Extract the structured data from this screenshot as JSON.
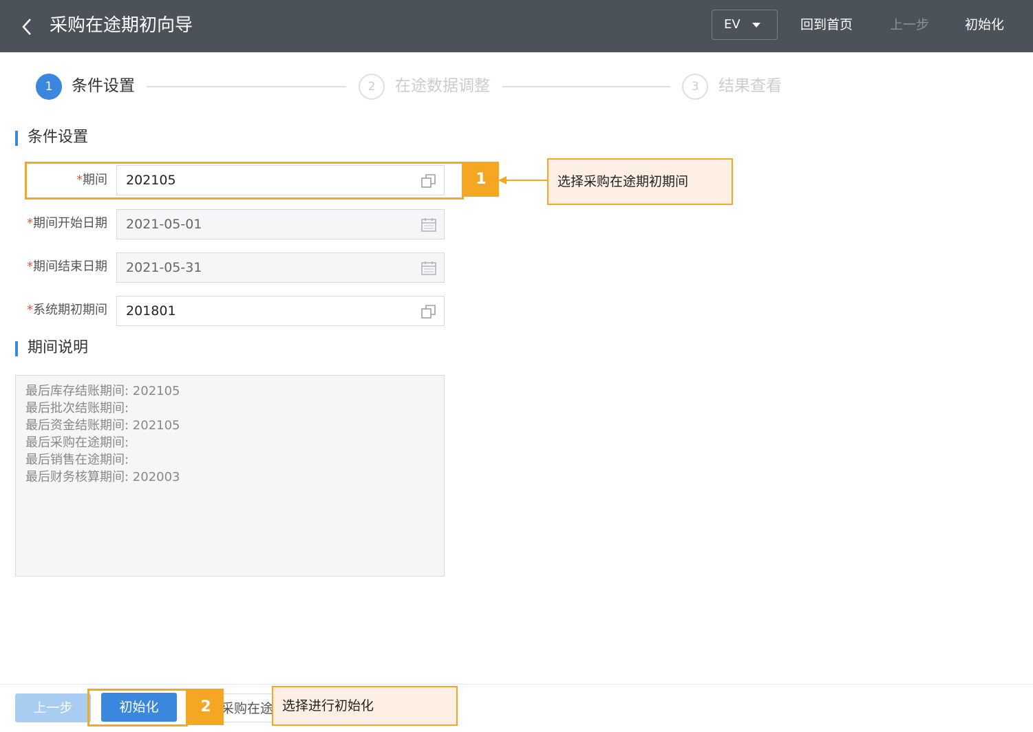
{
  "header": {
    "title": "采购在途期初向导",
    "org_select": "EV",
    "home_label": "回到首页",
    "prev_label": "上一步",
    "init_label": "初始化"
  },
  "steps": [
    {
      "num": "1",
      "label": "条件设置",
      "state": "active"
    },
    {
      "num": "2",
      "label": "在途数据调整",
      "state": "inactive"
    },
    {
      "num": "3",
      "label": "结果查看",
      "state": "inactive"
    }
  ],
  "sections": {
    "conditions": "条件设置",
    "period_note": "期间说明"
  },
  "form": {
    "required_mark": "*",
    "period": {
      "label": "期间",
      "value": "202105"
    },
    "start_date": {
      "label": "期间开始日期",
      "value": "2021-05-01"
    },
    "end_date": {
      "label": "期间结束日期",
      "value": "2021-05-31"
    },
    "system_period": {
      "label": "系统期初期间",
      "value": "201801"
    }
  },
  "period_note": {
    "lines": [
      "最后库存结账期间: 202105",
      "最后批次结账期间:",
      "最后资金结账期间: 202105",
      "最后采购在途期间:",
      "最后销售在途期间:",
      "最后财务核算期间: 202003"
    ]
  },
  "footer": {
    "prev_label": "上一步",
    "init_label": "初始化",
    "peek_label": "采购在途"
  },
  "annotations": {
    "badge1": "1",
    "callout1": "选择采购在途期初期间",
    "badge2": "2",
    "callout2": "选择进行初始化"
  },
  "colors": {
    "header_bg": "#4b525a",
    "accent": "#3a87dd",
    "annotation": "#f5a623",
    "callout_bg": "#fdefe4",
    "required": "#e8583c"
  },
  "icons": {
    "back": "chevron-left-icon",
    "dropdown": "caret-down-icon",
    "lookup": "copy-icon",
    "calendar": "calendar-icon"
  }
}
